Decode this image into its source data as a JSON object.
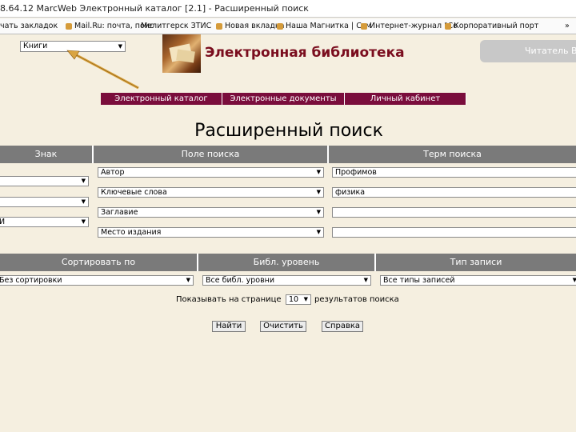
{
  "browser": {
    "title": "8.64.12 MarcWeb Электронный каталог [2.1] - Расширенный поиск",
    "bookmarks": [
      "чать закладок",
      "Mail.Ru: почта, поис",
      "Мелитгерск ЗТИС",
      "Новая вкладка",
      "Наша Магнитка | Ссм",
      "Интернет-журнал \"Со",
      "Корпоративный порт"
    ]
  },
  "header": {
    "collection_select": "Книги",
    "site_title": "Электронная библиотека",
    "reader_button": "Читатель В"
  },
  "nav": {
    "tabs": [
      "Электронный каталог",
      "Электронные документы",
      "Личный кабинет"
    ]
  },
  "search": {
    "heading": "Расширенный поиск",
    "columns": [
      "Знак",
      "Поле поиска",
      "Терм поиска"
    ],
    "rows": [
      {
        "sign": "",
        "field": "Автор",
        "term": "Профимов"
      },
      {
        "sign": "",
        "field": "Ключевые слова",
        "term": "физика"
      },
      {
        "sign": "",
        "field": "Заглавие",
        "term": ""
      },
      {
        "sign": "И",
        "field": "Место издания",
        "term": ""
      }
    ]
  },
  "options": {
    "columns": [
      "Сортировать по",
      "Библ. уровень",
      "Тип записи"
    ],
    "sort_value": "Без сортировки",
    "level_value": "Все библ. уровни",
    "type_value": "Все типы записей",
    "show_label": "Показывать на странице",
    "page_size": "10",
    "results_label": "результатов поиска"
  },
  "buttons": {
    "find": "Найти",
    "clear": "Очистить",
    "help": "Справка"
  },
  "colors": {
    "background": "#f5efe0",
    "nav": "#7a0d3c",
    "title": "#7a0d1e",
    "header_bar": "#7a7a7a",
    "pointer": "#d9a441"
  }
}
